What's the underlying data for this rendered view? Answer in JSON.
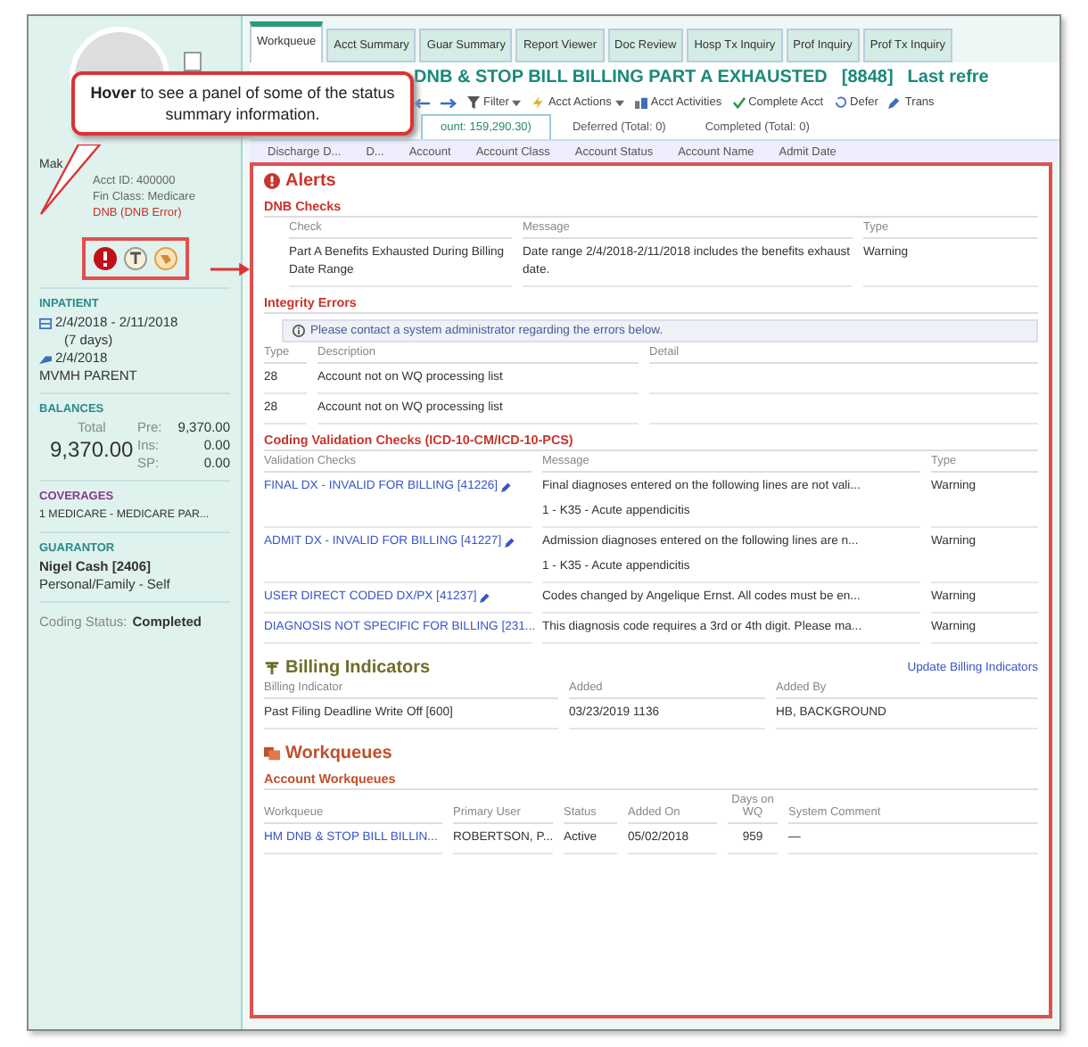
{
  "callout": {
    "text": "**Hover** to see a panel of some of the status summary information."
  },
  "sidebar": {
    "name": "Mak",
    "acct_id": "Acct ID: 400000",
    "fin_class": "Fin Class: Medicare",
    "dnb": "DNB (DNB Error)",
    "encounter": {
      "heading": "INPATIENT",
      "dates": "2/4/2018 - 2/11/2018",
      "days": "(7 days)",
      "discharge": "2/4/2018",
      "location": "MVMH PARENT"
    },
    "balances": {
      "heading": "BALANCES",
      "total_label": "Total",
      "total": "9,370.00",
      "rows": [
        {
          "label": "Pre:",
          "value": "9,370.00"
        },
        {
          "label": "Ins:",
          "value": "0.00"
        },
        {
          "label": "SP:",
          "value": "0.00"
        }
      ]
    },
    "coverages": {
      "heading": "COVERAGES",
      "items": [
        "1  MEDICARE - MEDICARE PAR..."
      ]
    },
    "guarantor": {
      "heading": "GUARANTOR",
      "name": "Nigel Cash [2406]",
      "relation": "Personal/Family - Self"
    },
    "coding_status": {
      "label": "Coding Status:",
      "value": "Completed"
    }
  },
  "tabs": [
    {
      "label": "Workqueue",
      "selected": true
    },
    {
      "label": "Acct Summary",
      "selected": false
    },
    {
      "label": "Guar Summary",
      "selected": false
    },
    {
      "label": "Report Viewer",
      "selected": false
    },
    {
      "label": "Doc Review",
      "selected": false
    },
    {
      "label": "Hosp Tx Inquiry",
      "selected": false
    },
    {
      "label": "Prof Inquiry",
      "selected": false
    },
    {
      "label": "Prof Tx Inquiry",
      "selected": false
    }
  ],
  "title": {
    "text": "DNB & STOP BILL BILLING PART A EXHAUSTED",
    "id": "[8848]",
    "refresh": "Last refre"
  },
  "toolbar": [
    {
      "kind": "back"
    },
    {
      "kind": "forward"
    },
    {
      "kind": "filter",
      "label": "Filter"
    },
    {
      "kind": "actions",
      "label": "Acct Actions"
    },
    {
      "kind": "activities",
      "label": "Acct Activities"
    },
    {
      "kind": "complete",
      "label": "Complete Acct"
    },
    {
      "kind": "defer",
      "label": "Defer"
    },
    {
      "kind": "transfer",
      "label": "Trans"
    }
  ],
  "subtabs": [
    {
      "label": "ount: 159,290.30)",
      "selected": true
    },
    {
      "label": "Deferred (Total: 0)",
      "selected": false
    },
    {
      "label": "Completed (Total: 0)",
      "selected": false
    }
  ],
  "columns": [
    "Discharge D...",
    "D...",
    "Account",
    "Account Class",
    "Account Status",
    "Account Name",
    "Admit Date"
  ],
  "panel": {
    "title": "Alerts",
    "dnb": {
      "title": "DNB Checks",
      "columns": [
        "Check",
        "Message",
        "Type"
      ],
      "rows": [
        [
          "Part A Benefits Exhausted During Billing Date Range",
          "Date range 2/4/2018-2/11/2018 includes the benefits exhaust date.",
          "Warning"
        ]
      ]
    },
    "integrity": {
      "title": "Integrity Errors",
      "info": "Please contact a system administrator regarding the errors below.",
      "columns": [
        "Type",
        "Description",
        "Detail"
      ],
      "rows": [
        [
          "28",
          "Account not on WQ processing list"
        ],
        [
          "28",
          "Account not on WQ processing list"
        ]
      ]
    },
    "coding": {
      "title": "Coding Validation Checks (ICD-10-CM/ICD-10-PCS)",
      "columns": [
        "Validation Checks",
        "Message",
        "Type"
      ],
      "rows": [
        {
          "check": "FINAL DX - INVALID FOR BILLING [41226]",
          "edit": true,
          "message": "Final diagnoses entered on the following lines are not vali...",
          "detail": "1 - K35 - Acute appendicitis",
          "type": "Warning"
        },
        {
          "check": "ADMIT DX - INVALID FOR BILLING [41227]",
          "edit": true,
          "message": "Admission diagnoses entered on the following lines are n...",
          "detail": "1 - K35 - Acute appendicitis",
          "type": "Warning"
        },
        {
          "check": "USER DIRECT CODED DX/PX [41237]",
          "edit": true,
          "message": "Codes changed by Angelique Ernst. All codes must be en...",
          "type": "Warning"
        },
        {
          "check": "DIAGNOSIS NOT SPECIFIC FOR BILLING [231...",
          "edit": false,
          "message": "This diagnosis code requires a 3rd or 4th digit. Please ma...",
          "type": "Warning"
        }
      ]
    },
    "billing": {
      "title": "Billing Indicators",
      "link": "Update Billing Indicators",
      "columns": [
        "Billing Indicator",
        "Added",
        "Added By"
      ],
      "rows": [
        [
          "Past Filing Deadline Write Off  [600]",
          "03/23/2019 1136",
          "HB, BACKGROUND"
        ]
      ]
    },
    "workqueues": {
      "title": "Workqueues",
      "subtitle": "Account Workqueues",
      "columns": [
        "Workqueue",
        "Primary User",
        "Status",
        "Added On",
        "Days on WQ",
        "System Comment"
      ],
      "rows": [
        [
          "HM DNB & STOP BILL BILLIN...",
          "ROBERTSON, P...",
          "Active",
          "05/02/2018",
          "959",
          "—"
        ]
      ]
    }
  }
}
